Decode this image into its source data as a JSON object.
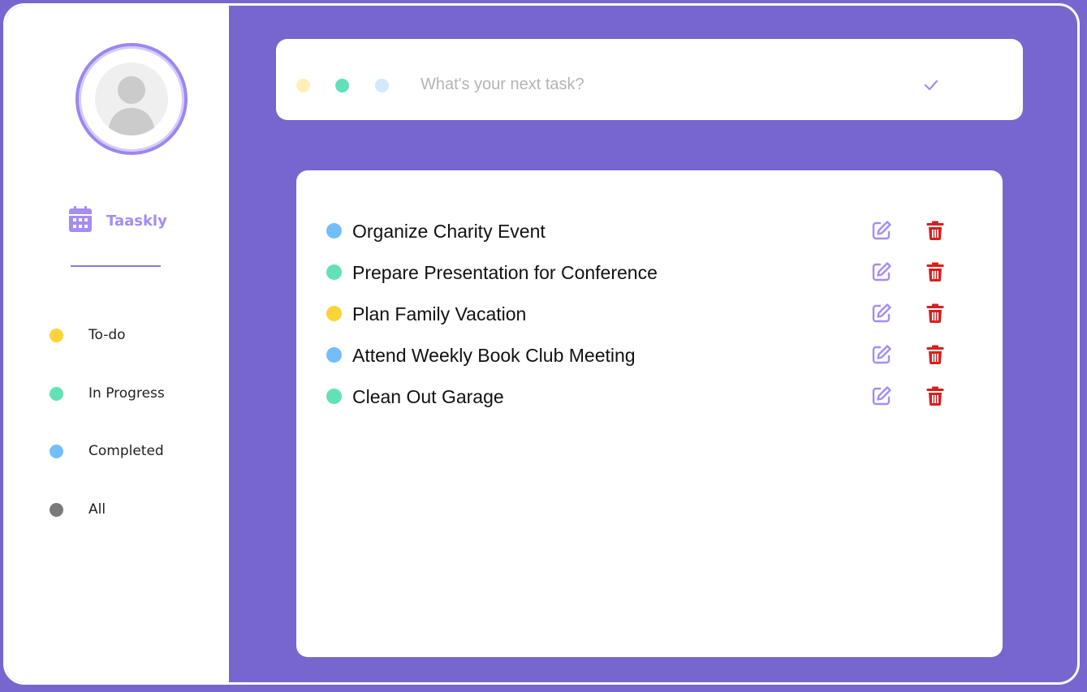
{
  "brand": {
    "name": "Taaskly",
    "icon": "calendar-icon"
  },
  "filters": [
    {
      "label": "To-do",
      "color": "#fdd33a"
    },
    {
      "label": "In Progress",
      "color": "#62e1b6"
    },
    {
      "label": "Completed",
      "color": "#74bdfb"
    },
    {
      "label": "All",
      "color": "#7a7a7a"
    }
  ],
  "new_task": {
    "placeholder": "What's your next task?",
    "value": "",
    "color_options": [
      "#fdefb6",
      "#62e1b6",
      "#d2e9fc"
    ]
  },
  "tasks": [
    {
      "title": "Organize Charity Event",
      "color": "#74bdfb"
    },
    {
      "title": "Prepare Presentation for Conference",
      "color": "#62e1b6"
    },
    {
      "title": "Plan Family Vacation",
      "color": "#fdd33a"
    },
    {
      "title": "Attend Weekly Book Club Meeting",
      "color": "#74bdfb"
    },
    {
      "title": "Clean Out Garage",
      "color": "#62e1b6"
    }
  ],
  "colors": {
    "accent": "#7866cf",
    "accent_light": "#a58cf3",
    "delete": "#d71f1f"
  }
}
